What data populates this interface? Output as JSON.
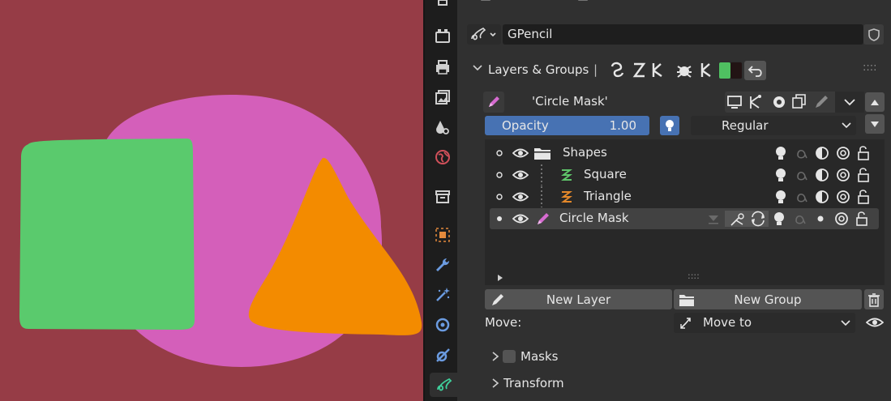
{
  "viewport": {
    "background": "#963c46",
    "shapes": [
      "pink-circle",
      "green-square",
      "orange-triangle"
    ]
  },
  "tabs": [
    "tool",
    "render",
    "output",
    "view-layer",
    "scene",
    "world",
    "collection",
    "object",
    "modifiers",
    "effects",
    "physics",
    "constraints",
    "data"
  ],
  "header": {
    "object_name": "GPencil"
  },
  "panel": {
    "title": "Layers & Groups",
    "separator": "|",
    "active_layer_name": "'Circle Mask'",
    "opacity_label": "Opacity",
    "opacity_value": "1.00",
    "blend_mode": "Regular",
    "layers": [
      {
        "name": "Shapes",
        "type": "group",
        "active": false
      },
      {
        "name": "Square",
        "type": "layer",
        "color": "#5fc46a",
        "active": false
      },
      {
        "name": "Triangle",
        "type": "layer",
        "color": "#e3882a",
        "active": false
      },
      {
        "name": "Circle Mask",
        "type": "layer",
        "color": "#d66bd0",
        "active": true
      }
    ],
    "list_grip": "::::",
    "new_layer_label": "New Layer",
    "new_group_label": "New Group",
    "move_label": "Move:",
    "move_value": "Move to",
    "sub_masks": "Masks",
    "sub_transform": "Transform"
  },
  "colors": {
    "accent_blue": "#4772b3",
    "green_swatch": "#4fc061",
    "bg_panel": "#303030"
  }
}
